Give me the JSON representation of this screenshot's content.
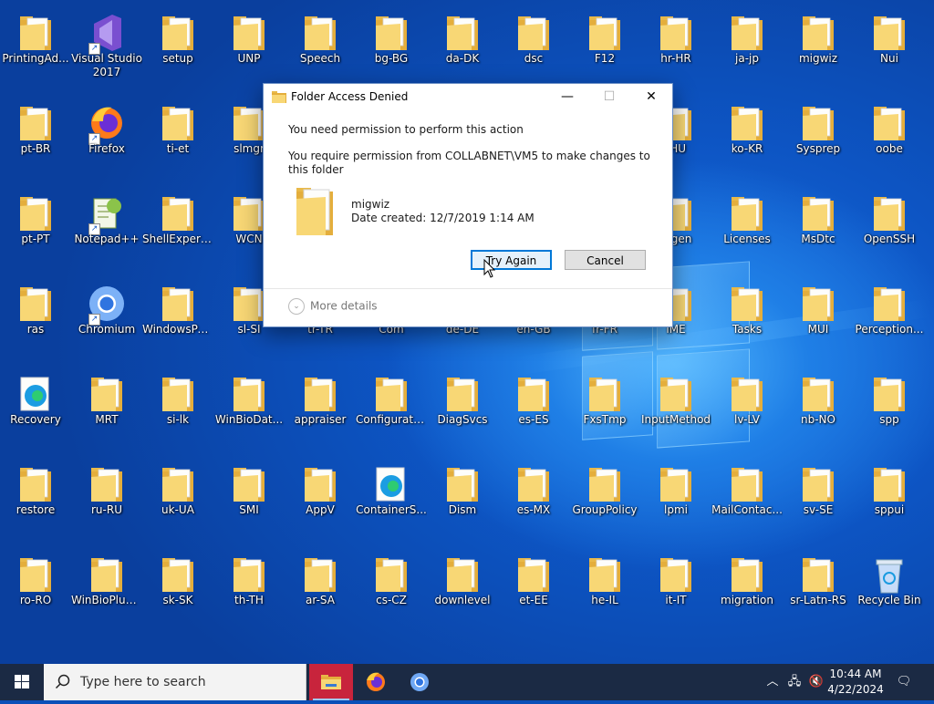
{
  "desktop": {
    "icons": [
      {
        "label": "PrintingAdmin",
        "display": "PrintingAd...",
        "type": "folder"
      },
      {
        "label": "Visual Studio 2017",
        "type": "vs",
        "shortcut": true
      },
      {
        "label": "setup",
        "type": "folder"
      },
      {
        "label": "UNP",
        "type": "folder"
      },
      {
        "label": "Speech",
        "type": "folder"
      },
      {
        "label": "bg-BG",
        "type": "folder"
      },
      {
        "label": "da-DK",
        "type": "folder"
      },
      {
        "label": "dsc",
        "type": "folder"
      },
      {
        "label": "F12",
        "type": "folder"
      },
      {
        "label": "hr-HR",
        "type": "folder"
      },
      {
        "label": "ja-jp",
        "type": "folder"
      },
      {
        "label": "migwiz",
        "type": "folder"
      },
      {
        "label": "Nui",
        "type": "folder"
      },
      {
        "label": "pt-BR",
        "type": "folder"
      },
      {
        "label": "Firefox",
        "type": "firefox",
        "shortcut": true
      },
      {
        "label": "ti-et",
        "type": "folder"
      },
      {
        "label": "slmgr",
        "type": "folder"
      },
      {
        "label": "",
        "type": "hidden"
      },
      {
        "label": "",
        "type": "hidden"
      },
      {
        "label": "",
        "type": "hidden"
      },
      {
        "label": "",
        "type": "hidden"
      },
      {
        "label": "",
        "type": "hidden"
      },
      {
        "label": "hu-HU",
        "display": "-HU",
        "type": "folder"
      },
      {
        "label": "ko-KR",
        "type": "folder"
      },
      {
        "label": "Sysprep",
        "type": "folder"
      },
      {
        "label": "oobe",
        "type": "folder"
      },
      {
        "label": "pt-PT",
        "type": "folder"
      },
      {
        "label": "Notepad++",
        "type": "notepad",
        "shortcut": true
      },
      {
        "label": "ShellExperiences",
        "display": "ShellExperi...",
        "type": "folder"
      },
      {
        "label": "WCN",
        "type": "folder"
      },
      {
        "label": "",
        "type": "hidden"
      },
      {
        "label": "",
        "type": "hidden"
      },
      {
        "label": "",
        "type": "hidden"
      },
      {
        "label": "",
        "type": "hidden"
      },
      {
        "label": "",
        "type": "hidden"
      },
      {
        "label": "Hydrogen",
        "display": "rogen",
        "type": "folder"
      },
      {
        "label": "Licenses",
        "type": "folder"
      },
      {
        "label": "MsDtc",
        "type": "folder"
      },
      {
        "label": "OpenSSH",
        "type": "folder"
      },
      {
        "label": "ras",
        "type": "folder"
      },
      {
        "label": "Chromium",
        "type": "chromium",
        "shortcut": true
      },
      {
        "label": "WindowsPowerShell",
        "display": "WindowsPo...",
        "type": "folder"
      },
      {
        "label": "sl-SI",
        "type": "folder"
      },
      {
        "label": "tr-TR",
        "type": "folder"
      },
      {
        "label": "Com",
        "type": "folder"
      },
      {
        "label": "de-DE",
        "type": "folder"
      },
      {
        "label": "en-GB",
        "type": "folder"
      },
      {
        "label": "fr-FR",
        "type": "folder"
      },
      {
        "label": "IME",
        "type": "folder"
      },
      {
        "label": "Tasks",
        "type": "folder"
      },
      {
        "label": "MUI",
        "type": "folder"
      },
      {
        "label": "Perception...",
        "type": "folder"
      },
      {
        "label": "Recovery",
        "type": "edge"
      },
      {
        "label": "MRT",
        "type": "folder"
      },
      {
        "label": "si-lk",
        "type": "folder"
      },
      {
        "label": "WinBioDatabase",
        "display": "WinBioDat...",
        "type": "folder"
      },
      {
        "label": "appraiser",
        "type": "folder"
      },
      {
        "label": "Configuration",
        "type": "folder"
      },
      {
        "label": "DiagSvcs",
        "type": "folder"
      },
      {
        "label": "es-ES",
        "type": "folder"
      },
      {
        "label": "FxsTmp",
        "type": "folder"
      },
      {
        "label": "InputMethod",
        "type": "folder"
      },
      {
        "label": "lv-LV",
        "type": "folder"
      },
      {
        "label": "nb-NO",
        "type": "folder"
      },
      {
        "label": "spp",
        "type": "folder"
      },
      {
        "label": "restore",
        "type": "folder"
      },
      {
        "label": "ru-RU",
        "type": "folder"
      },
      {
        "label": "uk-UA",
        "type": "folder"
      },
      {
        "label": "SMI",
        "type": "folder"
      },
      {
        "label": "AppV",
        "type": "folder"
      },
      {
        "label": "ContainerSettings",
        "display": "ContainerS...",
        "type": "edge"
      },
      {
        "label": "Dism",
        "type": "folder"
      },
      {
        "label": "es-MX",
        "type": "folder"
      },
      {
        "label": "GroupPolicy",
        "type": "folder"
      },
      {
        "label": "lpmi",
        "type": "folder"
      },
      {
        "label": "MailContacts",
        "display": "MailContac...",
        "type": "folder"
      },
      {
        "label": "sv-SE",
        "type": "folder"
      },
      {
        "label": "sppui",
        "type": "folder"
      },
      {
        "label": "ro-RO",
        "type": "folder"
      },
      {
        "label": "WinBioPlugins",
        "display": "WinBioPlug...",
        "type": "folder"
      },
      {
        "label": "sk-SK",
        "type": "folder"
      },
      {
        "label": "th-TH",
        "type": "folder"
      },
      {
        "label": "ar-SA",
        "type": "folder"
      },
      {
        "label": "cs-CZ",
        "type": "folder"
      },
      {
        "label": "downlevel",
        "type": "folder"
      },
      {
        "label": "et-EE",
        "type": "folder"
      },
      {
        "label": "he-IL",
        "type": "folder"
      },
      {
        "label": "it-IT",
        "type": "folder"
      },
      {
        "label": "migration",
        "type": "folder"
      },
      {
        "label": "sr-Latn-RS",
        "type": "folder"
      },
      {
        "label": "Recycle Bin",
        "type": "recycle"
      }
    ]
  },
  "dialog": {
    "title": "Folder Access Denied",
    "message": "You need permission to perform this action",
    "detail": "You require permission from COLLABNET\\VM5 to make changes to this folder",
    "item_name": "migwiz",
    "item_date": "Date created: 12/7/2019 1:14 AM",
    "try_again_label": "Try Again",
    "cancel_label": "Cancel",
    "more_details_label": "More details",
    "minimize_glyph": "—",
    "maximize_glyph": "☐",
    "close_glyph": "✕"
  },
  "taskbar": {
    "search_placeholder": "Type here to search",
    "apps": [
      "file-explorer",
      "firefox",
      "chromium"
    ],
    "time": "10:44 AM",
    "date": "4/22/2024"
  }
}
